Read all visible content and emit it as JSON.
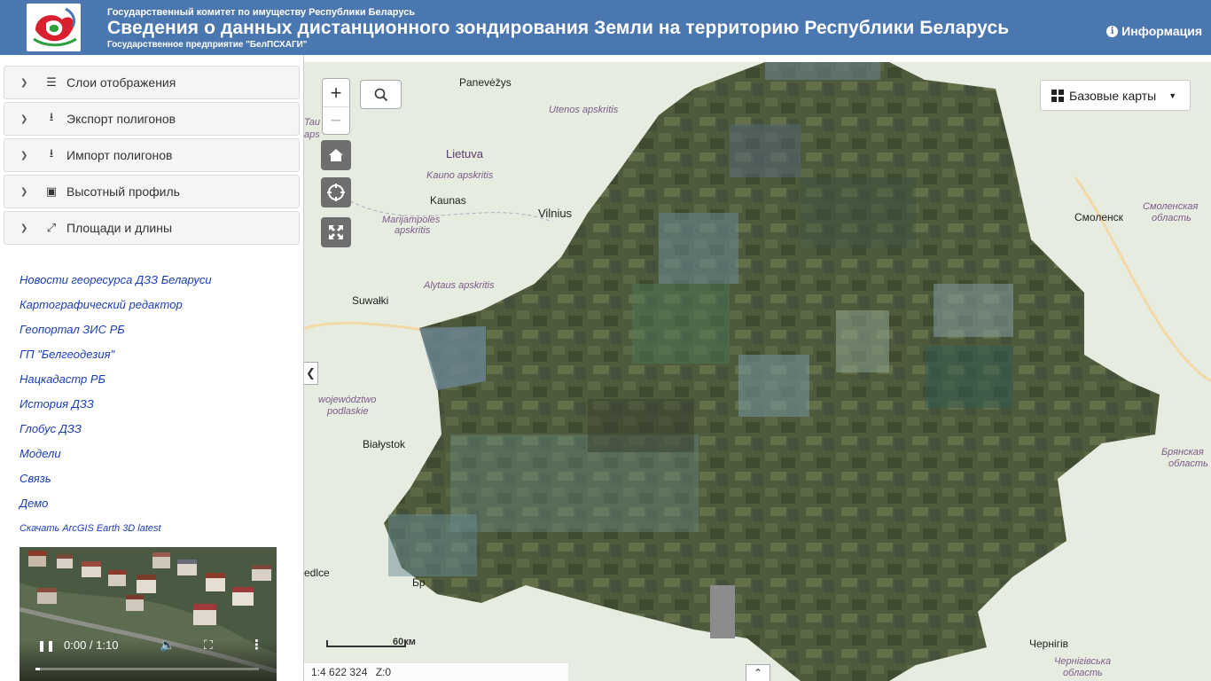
{
  "header": {
    "org": "Государственный комитет по имуществу Республики Беларусь",
    "title": "Сведения о данных дистанционного зондирования Земли на территорию Республики Беларусь",
    "subtitle": "Государственное предприятие \"БелПСХАГИ\"",
    "info_label": "Информация"
  },
  "sidebar": {
    "panels": [
      {
        "label": "Слои отображения",
        "icon": "list-icon"
      },
      {
        "label": "Экспорт полигонов",
        "icon": "upload-icon"
      },
      {
        "label": "Импорт полигонов",
        "icon": "download-icon"
      },
      {
        "label": "Высотный профиль",
        "icon": "bar-chart-icon"
      },
      {
        "label": "Площади и длины",
        "icon": "resize-icon"
      }
    ],
    "links": [
      "Новости георесурса ДЗЗ Беларуси",
      "Картографический редактор",
      "Геопортал ЗИС РБ",
      "ГП \"Белгеодезия\"",
      "Нацкадастр РБ",
      "История ДЗЗ",
      "Глобус ДЗЗ",
      "Модели",
      "Связь",
      "Демо",
      "Скачать ArcGIS Earth 3D latest"
    ],
    "video": {
      "time": "0:00 / 1:10",
      "progress": 0.02
    }
  },
  "map": {
    "basemaps_label": "Базовые карты",
    "zoom_in": "+",
    "zoom_out": "−",
    "scale_text": "1:4 622 324",
    "zoom_level": "Z:0",
    "scale_bar_label": "60км",
    "labels": {
      "panevezys": "Panevėžys",
      "utenos": "Utenos apskritis",
      "lietuva": "Lietuva",
      "kauno": "Kauno apskritis",
      "kaunas": "Kaunas",
      "vilnius": "Vilnius",
      "marijampoles": "Marijampolės",
      "marijampoles2": "apskritis",
      "alytaus": "Alytaus apskritis",
      "suwalki": "Suwałki",
      "taura": "Tau",
      "taura2": "aps",
      "smolensk": "Смоленск",
      "smolensk_obl": "Смоленская",
      "smolensk_obl2": "область",
      "podlaskie": "województwo",
      "podlaskie2": "podlaskie",
      "bialystok": "Białystok",
      "bryansk_obl": "Брянская",
      "bryansk_obl2": "область",
      "siedlce": "edlce",
      "brest": "Бр",
      "chernihiv": "Чернігів",
      "chernihiv_obl": "Чернігівська",
      "chernihiv_obl2": "область"
    }
  }
}
